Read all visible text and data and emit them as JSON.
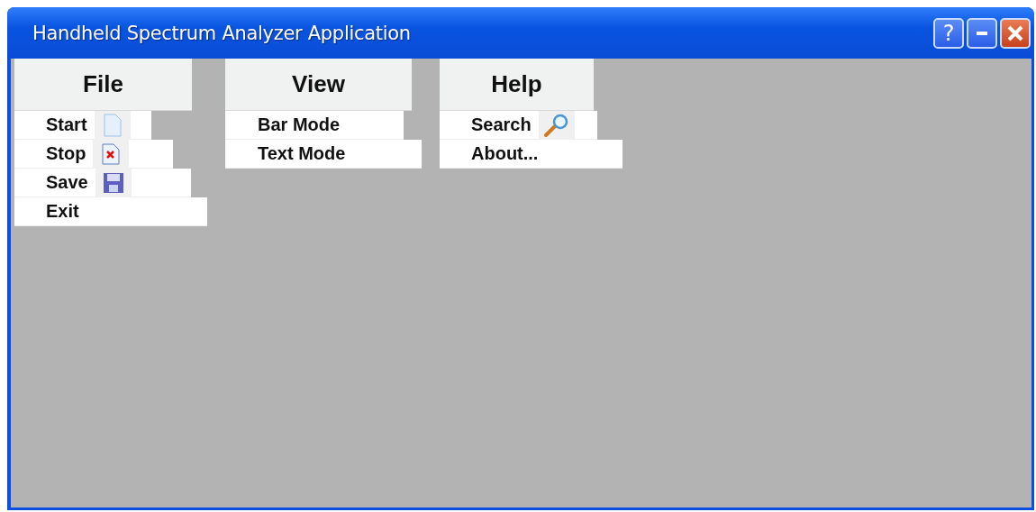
{
  "window": {
    "title": "Handheld Spectrum Analyzer Application",
    "help_button": "?"
  },
  "menus": [
    {
      "label": "File",
      "items": [
        {
          "label": "Start"
        },
        {
          "label": "Stop"
        },
        {
          "label": "Save"
        },
        {
          "label": "Exit"
        }
      ]
    },
    {
      "label": "View",
      "items": [
        {
          "label": "Bar Mode"
        },
        {
          "label": "Text Mode"
        }
      ]
    },
    {
      "label": "Help",
      "items": [
        {
          "label": "Search"
        },
        {
          "label": "About..."
        }
      ]
    }
  ]
}
